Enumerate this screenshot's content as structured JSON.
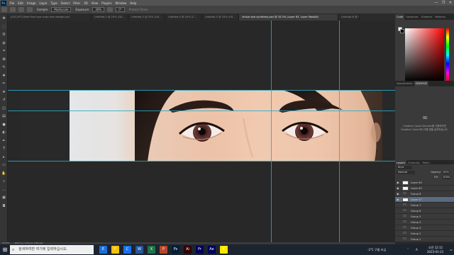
{
  "menubar": {
    "app_logo": "Ps",
    "items": [
      "File",
      "Edit",
      "Image",
      "Layer",
      "Type",
      "Select",
      "Filter",
      "3D",
      "View",
      "Plugins",
      "Window",
      "Help"
    ],
    "window_controls": [
      "—",
      "❐",
      "✕"
    ]
  },
  "options": {
    "sample_label": "Sample:",
    "sample_value": "Multiscale",
    "exposure_label": "Exposure:",
    "exposure_value": "30%",
    "angle_value": "0°",
    "protect_label": "Protect Tones"
  },
  "tabs": [
    {
      "label": "[GV11PT] Best Final eye cross lens design.psd"
    },
    {
      "label": "Untitled-2 @ 25% (GS..."
    },
    {
      "label": "Untitled-3 @ 25% (GS..."
    },
    {
      "label": "Untitled-4 @ 25% (C..."
    },
    {
      "label": "Untitled-5 @ 25% (GS..."
    },
    {
      "label": "virtual eye synthesis.psd @ 33.3% (Layer 63, Layer Mask/8)",
      "active": true
    },
    {
      "label": "Untitled-6 @ 33..."
    }
  ],
  "toolbar": {
    "tools": [
      "move-icon",
      "marquee-icon",
      "lasso-icon",
      "quick-select-icon",
      "crop-icon",
      "frame-icon",
      "eyedropper-icon",
      "healing-icon",
      "brush-icon",
      "stamp-icon",
      "history-brush-icon",
      "eraser-icon",
      "gradient-icon",
      "blur-icon",
      "dodge-icon",
      "pen-icon",
      "type-icon",
      "path-select-icon",
      "shape-icon",
      "hand-icon",
      "zoom-icon",
      "more-icon",
      "swatch-icon",
      "quickmask-icon"
    ],
    "glyphs": [
      "✥",
      "⬚",
      "ʘ",
      "◍",
      "⌗",
      "⊠",
      "✎",
      "✚",
      "✏",
      "⎈",
      "↺",
      "◫",
      "▤",
      "●",
      "◐",
      "✒",
      "T",
      "▸",
      "▭",
      "✋",
      "⌕",
      "…",
      "▣",
      "◘"
    ]
  },
  "panels": {
    "color_tabs": [
      "Color",
      "Swatches",
      "Gradient",
      "Patterns"
    ],
    "library_tabs": [
      "Adjustments",
      "라이브러리"
    ],
    "library_message": "Creative Cloud Libraries를 사용하려면 Creative Cloud 데스크톱 앱을 설치하십시오.",
    "layers_tabs": [
      "Layers",
      "Channels",
      "Paths"
    ],
    "layers_filter": "Kind",
    "blend_mode": "Normal",
    "opacity_label": "Opacity:",
    "opacity_value": "62%",
    "fill_label": "Fill:",
    "fill_value": "100%",
    "layers": [
      {
        "name": "Layer 64",
        "type": "layer",
        "visible": true
      },
      {
        "name": "Layer 62",
        "type": "layer",
        "visible": true
      },
      {
        "name": "Group 8",
        "type": "group",
        "visible": true
      },
      {
        "name": "Layer 57",
        "type": "layer",
        "visible": true,
        "selected": true
      },
      {
        "name": "Group 7",
        "type": "group",
        "visible": false
      },
      {
        "name": "Group 6",
        "type": "group",
        "visible": false
      },
      {
        "name": "Group 5",
        "type": "group",
        "visible": false
      },
      {
        "name": "Group 4",
        "type": "group",
        "visible": false
      },
      {
        "name": "Group 3",
        "type": "group",
        "visible": false
      },
      {
        "name": "Group 2",
        "type": "group",
        "visible": false
      },
      {
        "name": "Group 1",
        "type": "group",
        "visible": false
      }
    ]
  },
  "statusbar": {
    "zoom": "33.33%",
    "doc_info": "9024 px x 3112 px (300 ppi)"
  },
  "taskbar": {
    "search_placeholder": "검색하려면 여기에 입력하십시오.",
    "apps": [
      "E",
      "F",
      "C",
      "W",
      "X",
      "P",
      "Ps",
      "Ai",
      "Pr",
      "Ae",
      "K"
    ],
    "tray_temp": "-2°C 구름 조금",
    "tray_ime": "A",
    "clock_time": "오전 12:11",
    "clock_date": "2023-01-21"
  },
  "colors": {
    "guide": "#2aa9c5",
    "selected_layer": "#5a6a80",
    "accent": "#31a8ff"
  }
}
